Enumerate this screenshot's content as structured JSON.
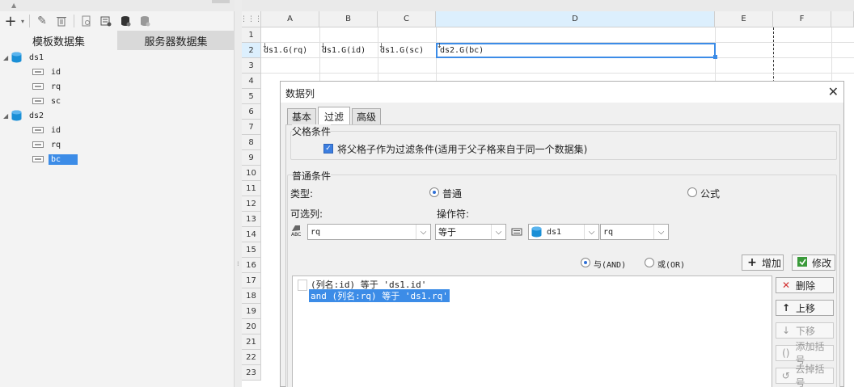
{
  "left_panel": {
    "tabs": [
      "模板数据集",
      "服务器数据集"
    ],
    "datasets": [
      {
        "name": "ds1",
        "fields": [
          "id",
          "rq",
          "sc"
        ]
      },
      {
        "name": "ds2",
        "fields": [
          "id",
          "rq",
          "bc"
        ]
      }
    ],
    "selected_field": "bc"
  },
  "sheet": {
    "columns": [
      "A",
      "B",
      "C",
      "D",
      "E",
      "F"
    ],
    "rows": [
      "1",
      "2",
      "3",
      "4",
      "5",
      "6",
      "7",
      "8",
      "9",
      "10",
      "11",
      "12",
      "13",
      "14",
      "15",
      "16",
      "17",
      "18",
      "19",
      "20",
      "21",
      "22",
      "23"
    ],
    "cells": {
      "A2": "ds1.G(rq)",
      "B2": "ds1.G(id)",
      "C2": "ds1.G(sc)",
      "D2": "ds2.G(bc)"
    }
  },
  "dialog": {
    "title": "数据列",
    "tabs": [
      "基本",
      "过滤",
      "高级"
    ],
    "active_tab": "过滤",
    "parent_group": "父格条件",
    "parent_checkbox_label": "将父格子作为过滤条件(适用于父子格来自于同一个数据集)",
    "normal_group": "普通条件",
    "type_label": "类型:",
    "type_options": [
      "普通",
      "公式"
    ],
    "selectable_col_label": "可选列:",
    "operator_label": "操作符:",
    "column_value": "rq",
    "operator_value": "等于",
    "dataset_value": "ds1",
    "value_column": "rq",
    "logic_options": [
      "与(AND)",
      "或(OR)"
    ],
    "add_button": "增加",
    "modify_button": "修改",
    "conditions": [
      "(列名:id) 等于 'ds1.id'",
      "and (列名:rq) 等于 'ds1.rq'"
    ],
    "side_buttons": [
      "删除",
      "上移",
      "下移",
      "添加括号",
      "去掉括号"
    ],
    "accent": "#3c8ce7"
  }
}
